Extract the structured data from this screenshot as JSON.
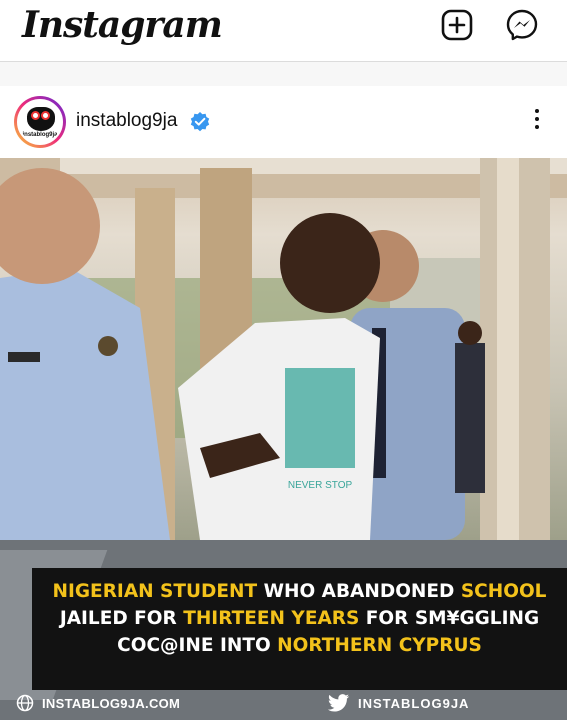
{
  "app": {
    "title": "Instagram",
    "icons": [
      "add-post-icon",
      "messenger-icon"
    ]
  },
  "post": {
    "username": "instablog9ja",
    "avatar_text": "instablog9ja",
    "verified": true,
    "photo_shirt_text": "NEVER STOP",
    "caption_segments": [
      {
        "text": "NIGERIAN STUDENT",
        "highlight": true
      },
      {
        "text": " WHO ABANDONED ",
        "highlight": false
      },
      {
        "text": "SCHOOL",
        "highlight": true
      },
      {
        "text": " JAILED FOR ",
        "highlight": false
      },
      {
        "text": "THIRTEEN YEARS",
        "highlight": true
      },
      {
        "text": " FOR SM¥GGLING COC@INE INTO ",
        "highlight": false
      },
      {
        "text": "NORTHERN CYPRUS",
        "highlight": true
      }
    ],
    "footer": {
      "website": "INSTABLOG9JA.COM",
      "twitter_handle": "INSTABLOG9JA"
    }
  },
  "colors": {
    "highlight": "#f3c21b",
    "verified": "#3897f0",
    "banner_bg": "#6e7378",
    "caption_bg": "#121212"
  }
}
